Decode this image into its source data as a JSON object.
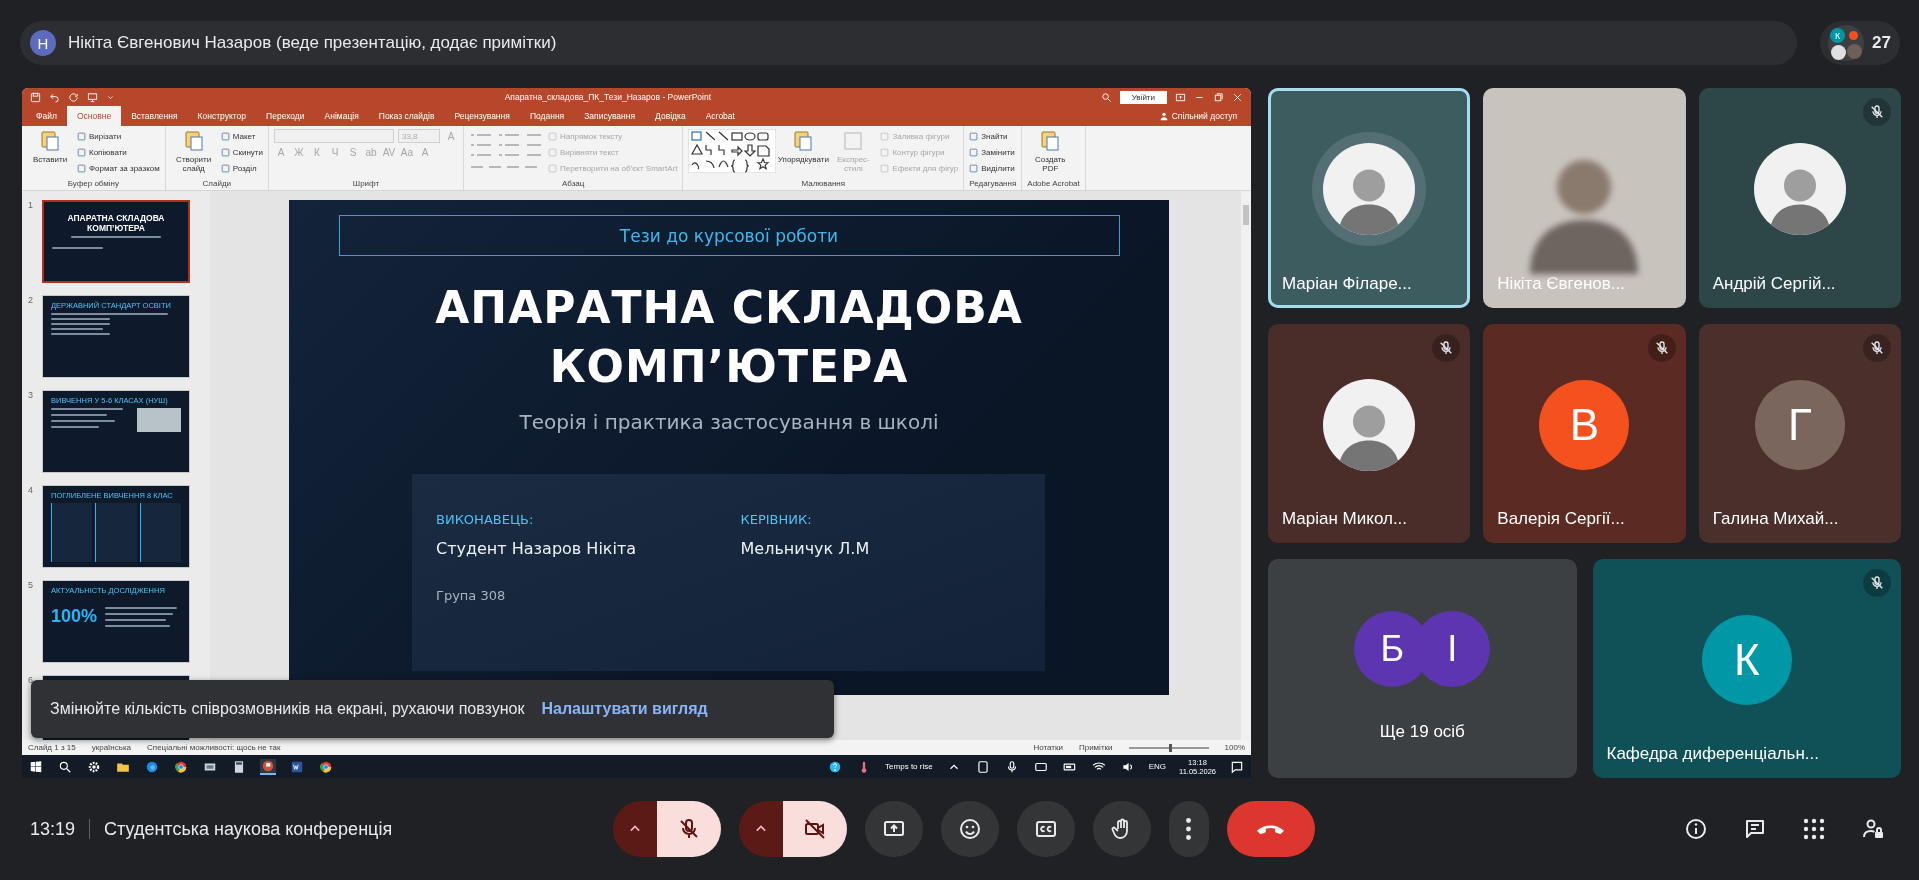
{
  "presenter_bar": {
    "avatar_letter": "Н",
    "text": "Нікіта Євгенович Назаров (веде презентацію, додає примітки)"
  },
  "participants": {
    "avatar_letter": "К",
    "count": "27"
  },
  "powerpoint": {
    "title": "Апаратна_складова_ПК_Тези_Назаров  -  PowerPoint",
    "sign_in": "Увійти",
    "share": "Спільний доступ",
    "tabs": [
      {
        "label": "Файл",
        "selected": false
      },
      {
        "label": "Основне",
        "selected": true
      },
      {
        "label": "Вставлення",
        "selected": false
      },
      {
        "label": "Конструктор",
        "selected": false
      },
      {
        "label": "Переходи",
        "selected": false
      },
      {
        "label": "Анімація",
        "selected": false
      },
      {
        "label": "Показ слайдів",
        "selected": false
      },
      {
        "label": "Рецензування",
        "selected": false
      },
      {
        "label": "Подання",
        "selected": false
      },
      {
        "label": "Записування",
        "selected": false
      },
      {
        "label": "Довідка",
        "selected": false
      },
      {
        "label": "Acrobat",
        "selected": false
      }
    ],
    "ribbon_groups": [
      {
        "label": "Буфер обміну",
        "items": [
          {
            "kind": "large",
            "label": "Вставити",
            "disabled": false
          },
          {
            "kind": "small",
            "label": "Вирізати",
            "disabled": false
          },
          {
            "kind": "small",
            "label": "Копіювати",
            "disabled": false
          },
          {
            "kind": "small",
            "label": "Формат за зразком",
            "disabled": false
          }
        ]
      },
      {
        "label": "Слайди",
        "items": [
          {
            "kind": "large",
            "label": "Створити слайд",
            "disabled": false
          },
          {
            "kind": "small",
            "label": "Макет",
            "disabled": false
          },
          {
            "kind": "small",
            "label": "Скинути",
            "disabled": false
          },
          {
            "kind": "small",
            "label": "Розділ",
            "disabled": false
          }
        ]
      },
      {
        "label": "Шрифт",
        "items": [
          {
            "kind": "field",
            "disabled": true
          },
          {
            "kind": "field",
            "label": "33,8",
            "disabled": true
          },
          {
            "kind": "glyph",
            "label": "A",
            "disabled": true
          },
          {
            "kind": "glyph",
            "label": "A",
            "disabled": true
          },
          {
            "kind": "glyph",
            "label": "Ж",
            "disabled": true
          },
          {
            "kind": "glyph",
            "label": "К",
            "disabled": true
          },
          {
            "kind": "glyph",
            "label": "Ч",
            "disabled": true
          },
          {
            "kind": "glyph",
            "label": "S",
            "disabled": true
          },
          {
            "kind": "glyph",
            "label": "ab",
            "disabled": true
          },
          {
            "kind": "glyph",
            "label": "AV",
            "disabled": true
          },
          {
            "kind": "glyph",
            "label": "Aa",
            "disabled": true
          },
          {
            "kind": "glyph",
            "label": "A",
            "disabled": true
          }
        ]
      },
      {
        "label": "Абзац",
        "items": [
          {
            "kind": "bullets",
            "disabled": true
          },
          {
            "kind": "small",
            "label": "Напрямок тексту",
            "disabled": true
          },
          {
            "kind": "small",
            "label": "Вирівняти текст",
            "disabled": true
          },
          {
            "kind": "small",
            "label": "Перетворити на об’єкт SmartArt",
            "disabled": true
          }
        ]
      },
      {
        "label": "Малювання",
        "items": [
          {
            "kind": "gallery",
            "disabled": false
          },
          {
            "kind": "large",
            "label": "Упорядкувати",
            "disabled": false
          },
          {
            "kind": "large",
            "label": "Експрес-стилі",
            "disabled": true
          },
          {
            "kind": "small",
            "label": "Заливка фігури",
            "disabled": true
          },
          {
            "kind": "small",
            "label": "Контур фігури",
            "disabled": true
          },
          {
            "kind": "small",
            "label": "Ефекти для фігур",
            "disabled": true
          }
        ]
      },
      {
        "label": "Редагування",
        "items": [
          {
            "kind": "small",
            "label": "Знайти",
            "disabled": false
          },
          {
            "kind": "small",
            "label": "Замінити",
            "disabled": false
          },
          {
            "kind": "small",
            "label": "Виділити",
            "disabled": false
          }
        ]
      },
      {
        "label": "Adobe Acrobat",
        "items": [
          {
            "kind": "large",
            "label": "Создать PDF",
            "disabled": false
          }
        ]
      }
    ],
    "thumbnails": [
      {
        "number": "1",
        "kind": "title",
        "title": "АПАРАТНА СКЛАДОВА КОМП’ЮТЕРА",
        "selected": true
      },
      {
        "number": "2",
        "kind": "list",
        "title": "ДЕРЖАВНИЙ СТАНДАРТ ОСВІТИ",
        "selected": false
      },
      {
        "number": "3",
        "kind": "photo",
        "title": "ВИВЧЕННЯ У 5-6 КЛАСАХ (НУШ)",
        "selected": false
      },
      {
        "number": "4",
        "kind": "columns",
        "title": "ПОГЛИБЛЕНЕ ВИВЧЕННЯ 8 КЛАС",
        "selected": false
      },
      {
        "number": "5",
        "kind": "stat",
        "title": "АКТУАЛЬНІСТЬ ДОСЛІДЖЕННЯ",
        "highlight": "100%",
        "selected": false
      },
      {
        "number": "6",
        "kind": "partial",
        "selected": false
      }
    ],
    "slide": {
      "header": "Тези до курсової роботи",
      "title": "АПАРАТНА СКЛАДОВА КОМП’ЮТЕРА",
      "subtitle": "Теорія і практика застосування в школі",
      "details": [
        {
          "label": "ВИКОНАВЕЦЬ:",
          "value": "Студент Назаров Нікіта"
        },
        {
          "label": "КЕРІВНИК:",
          "value": "Мельничук Л.М"
        }
      ],
      "group": "Група 308"
    },
    "status_bar": {
      "slide_counter": "Слайд 1 з 15",
      "language": "українська",
      "accessibility": "Спеціальні можливості: щось не так",
      "notes": "Нотатки",
      "comments": "Примітки",
      "zoom_slider": {
        "level": 0.5
      },
      "zoom": "100%"
    },
    "taskbar": {
      "weather": "Temps to rise",
      "language": "ENG",
      "time": "13:18",
      "date": "11.05.2026"
    }
  },
  "toast": {
    "text": "Змінюйте кількість співрозмовників на екрані, рухаючи повзунок",
    "action": "Налаштувати вигляд"
  },
  "tiles": [
    {
      "name": "Маріан Філаре...",
      "kind": "photo",
      "color": "#3d5c60",
      "muted": false,
      "speaking": true
    },
    {
      "name": "Нікіта Євгенов...",
      "kind": "video",
      "color": "#c9c3be",
      "muted": false,
      "speaking": false
    },
    {
      "name": "Андрій Сергій...",
      "kind": "photo",
      "color": "#2d4749",
      "muted": true,
      "speaking": false
    },
    {
      "name": "Маріан Микол...",
      "kind": "photo",
      "color": "#4a2d29",
      "muted": true,
      "speaking": false
    },
    {
      "name": "Валерія Сергії...",
      "kind": "letter",
      "color": "#5b2a22",
      "avatars": [
        {
          "letter": "В",
          "color": "#f4511e"
        }
      ],
      "muted": true,
      "speaking": false
    },
    {
      "name": "Галина Михай...",
      "kind": "letter",
      "color": "#4b2f2b",
      "avatars": [
        {
          "letter": "Г",
          "color": "#7b665e"
        }
      ],
      "muted": true,
      "speaking": false
    },
    {
      "name": "Ще 19 осіб",
      "kind": "others",
      "color": "#3c4043",
      "avatars": [
        {
          "letter": "Б",
          "color": "#5e35b1"
        },
        {
          "letter": "І",
          "color": "#5e35b1"
        }
      ],
      "muted": false,
      "speaking": false
    },
    {
      "name": "Кафедра диференціальн...",
      "kind": "letter",
      "color": "#0f5156",
      "avatars": [
        {
          "letter": "К",
          "color": "#0097a7"
        }
      ],
      "muted": true,
      "speaking": false
    }
  ],
  "meeting": {
    "time": "13:19",
    "title": "Студентська наукова конференція"
  },
  "controls": {
    "microphone": {
      "on": false
    },
    "camera": {
      "on": false
    }
  }
}
